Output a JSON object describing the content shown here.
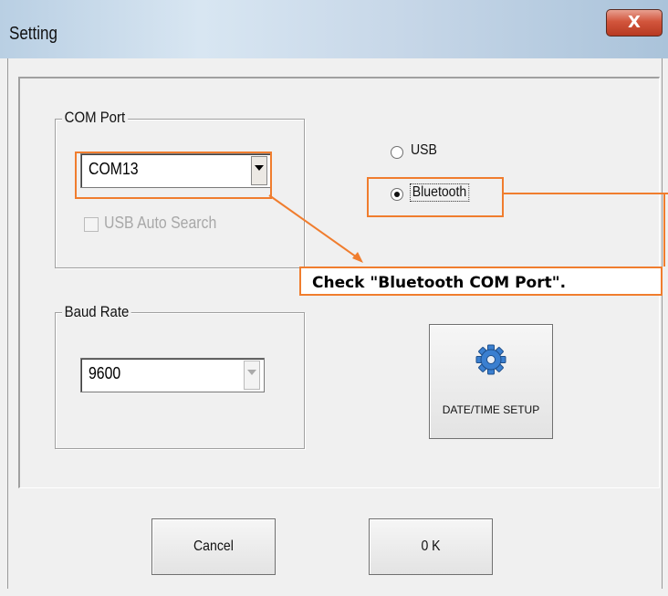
{
  "window": {
    "title": "Setting",
    "close_glyph": "X"
  },
  "com_port": {
    "group_title": "COM Port",
    "selected": "COM13",
    "usb_auto_search_label": "USB Auto Search",
    "usb_auto_search_checked": false,
    "usb_auto_search_enabled": false
  },
  "baud_rate": {
    "group_title": "Baud Rate",
    "selected": "9600",
    "enabled": false
  },
  "connection": {
    "options": [
      {
        "label": "USB",
        "selected": false
      },
      {
        "label": "Bluetooth",
        "selected": true
      }
    ]
  },
  "date_time_button": {
    "label": "DATE/TIME SETUP",
    "icon": "gear-icon"
  },
  "footer": {
    "cancel_label": "Cancel",
    "ok_label": "0 K"
  },
  "annotation": {
    "text": "Check \"Bluetooth COM Port\".",
    "color": "#f07d2e"
  },
  "colors": {
    "accent": "#f07d2e",
    "close": "#c9452b",
    "gear": "#3a7fd0"
  }
}
